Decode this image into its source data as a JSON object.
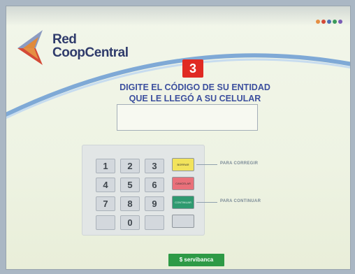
{
  "brand": {
    "line1": "Red",
    "line2": "CoopCentral"
  },
  "step": {
    "number": "3"
  },
  "instruction": {
    "line1": "DIGITE EL CÓDIGO DE SU ENTIDAD",
    "line2": "QUE LE LLEGÓ A SU CELULAR"
  },
  "code_field": {
    "value": ""
  },
  "keypad": {
    "keys": [
      "1",
      "2",
      "3",
      "4",
      "5",
      "6",
      "7",
      "8",
      "9",
      "",
      "0",
      ""
    ]
  },
  "function_keys": {
    "clear": {
      "label": "BORRAR",
      "color": "#f2e35c"
    },
    "cancel": {
      "label": "CANCELAR",
      "color": "#e9707a"
    },
    "continue": {
      "label": "CONTINUAR",
      "color": "#2f9a70"
    }
  },
  "side_labels": {
    "correct": "PARA CORREGIR",
    "continue": "PARA CONTINUAR"
  },
  "footer": {
    "brand": "servibanca"
  },
  "colors": {
    "brand_blue": "#2f3b6b",
    "text_blue": "#3c4f9e",
    "step_red": "#e02a23",
    "servibanca_green": "#2e9a46"
  }
}
